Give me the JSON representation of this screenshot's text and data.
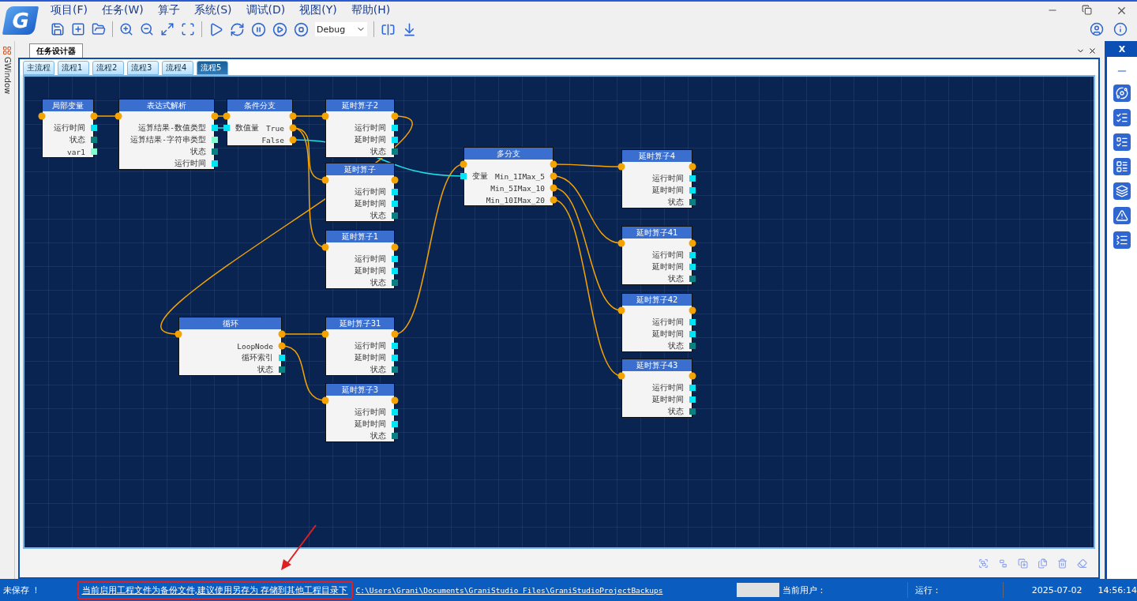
{
  "logo": "G",
  "menu": [
    "项目(F)",
    "任务(W)",
    "算子",
    "系统(S)",
    "调试(D)",
    "视图(Y)",
    "帮助(H)"
  ],
  "toolbar": {
    "mode": "Debug"
  },
  "side_strip": {
    "label": "GWindow"
  },
  "document_tab": {
    "title": "任务设计器"
  },
  "flow_tabs": [
    {
      "label": "主流程",
      "selected": false
    },
    {
      "label": "流程1",
      "selected": false
    },
    {
      "label": "流程2",
      "selected": false
    },
    {
      "label": "流程3",
      "selected": false
    },
    {
      "label": "流程4",
      "selected": false
    },
    {
      "label": "流程5",
      "selected": true
    }
  ],
  "nodes": [
    {
      "title": "局部变量",
      "exec_in": true,
      "exec_out": true,
      "rows": [
        {
          "right": {
            "label": "运行时间",
            "kind": "number"
          }
        },
        {
          "right": {
            "label": "状态",
            "kind": "status"
          }
        },
        {
          "right": {
            "label": "var1",
            "kind": "string"
          }
        }
      ]
    },
    {
      "title": "表达式解析",
      "exec_in": true,
      "exec_out": true,
      "rows": [
        {
          "right": {
            "label": "运算结果-数值类型",
            "kind": "number"
          }
        },
        {
          "right": {
            "label": "运算结果-字符串类型",
            "kind": "string"
          }
        },
        {
          "right": {
            "label": "状态",
            "kind": "status"
          }
        },
        {
          "right": {
            "label": "运行时间",
            "kind": "number"
          }
        }
      ]
    },
    {
      "title": "条件分支",
      "exec_in": true,
      "exec_out": true,
      "rows": [
        {
          "left": {
            "label": "数值量",
            "kind": "number"
          },
          "right": {
            "label": "True",
            "kind": "exec"
          }
        },
        {
          "right": {
            "label": "False",
            "kind": "exec"
          }
        }
      ]
    },
    {
      "title": "延时算子2",
      "exec_in": true,
      "exec_out": true,
      "rows": [
        {
          "right": {
            "label": "运行时间",
            "kind": "number"
          }
        },
        {
          "right": {
            "label": "延时时间",
            "kind": "number"
          }
        },
        {
          "right": {
            "label": "状态",
            "kind": "status"
          }
        }
      ]
    },
    {
      "title": "延时算子",
      "exec_in": true,
      "exec_out": true,
      "rows": [
        {
          "right": {
            "label": "运行时间",
            "kind": "number"
          }
        },
        {
          "right": {
            "label": "延时时间",
            "kind": "number"
          }
        },
        {
          "right": {
            "label": "状态",
            "kind": "status"
          }
        }
      ]
    },
    {
      "title": "延时算子1",
      "exec_in": true,
      "exec_out": true,
      "rows": [
        {
          "right": {
            "label": "运行时间",
            "kind": "number"
          }
        },
        {
          "right": {
            "label": "延时时间",
            "kind": "number"
          }
        },
        {
          "right": {
            "label": "状态",
            "kind": "status"
          }
        }
      ]
    },
    {
      "title": "循环",
      "exec_in": true,
      "exec_out": true,
      "rows": [
        {
          "right": {
            "label": "LoopNode",
            "kind": "exec"
          }
        },
        {
          "right": {
            "label": "循环索引",
            "kind": "number"
          }
        },
        {
          "right": {
            "label": "状态",
            "kind": "status"
          }
        }
      ]
    },
    {
      "title": "延时算子31",
      "exec_in": true,
      "exec_out": true,
      "rows": [
        {
          "right": {
            "label": "运行时间",
            "kind": "number"
          }
        },
        {
          "right": {
            "label": "延时时间",
            "kind": "number"
          }
        },
        {
          "right": {
            "label": "状态",
            "kind": "status"
          }
        }
      ]
    },
    {
      "title": "延时算子3",
      "exec_in": true,
      "exec_out": true,
      "rows": [
        {
          "right": {
            "label": "运行时间",
            "kind": "number"
          }
        },
        {
          "right": {
            "label": "延时时间",
            "kind": "number"
          }
        },
        {
          "right": {
            "label": "状态",
            "kind": "status"
          }
        }
      ]
    },
    {
      "title": "多分支",
      "exec_in": true,
      "exec_out": true,
      "rows": [
        {
          "left": {
            "label": "变量",
            "kind": "number"
          },
          "right": {
            "label": "Min_1IMax_5",
            "kind": "exec"
          }
        },
        {
          "right": {
            "label": "Min_5IMax_10",
            "kind": "exec"
          }
        },
        {
          "right": {
            "label": "Min_10IMax_20",
            "kind": "exec"
          }
        }
      ]
    },
    {
      "title": "延时算子4",
      "exec_in": true,
      "exec_out": true,
      "rows": [
        {
          "right": {
            "label": "运行时间",
            "kind": "number"
          }
        },
        {
          "right": {
            "label": "延时时间",
            "kind": "number"
          }
        },
        {
          "right": {
            "label": "状态",
            "kind": "status"
          }
        }
      ]
    },
    {
      "title": "延时算子41",
      "exec_in": true,
      "exec_out": true,
      "rows": [
        {
          "right": {
            "label": "运行时间",
            "kind": "number"
          }
        },
        {
          "right": {
            "label": "延时时间",
            "kind": "number"
          }
        },
        {
          "right": {
            "label": "状态",
            "kind": "status"
          }
        }
      ]
    },
    {
      "title": "延时算子42",
      "exec_in": true,
      "exec_out": true,
      "rows": [
        {
          "right": {
            "label": "运行时间",
            "kind": "number"
          }
        },
        {
          "right": {
            "label": "延时时间",
            "kind": "number"
          }
        },
        {
          "right": {
            "label": "状态",
            "kind": "status"
          }
        }
      ]
    },
    {
      "title": "延时算子43",
      "exec_in": true,
      "exec_out": true,
      "rows": [
        {
          "right": {
            "label": "运行时间",
            "kind": "number"
          }
        },
        {
          "right": {
            "label": "延时时间",
            "kind": "number"
          }
        },
        {
          "right": {
            "label": "状态",
            "kind": "status"
          }
        }
      ]
    }
  ],
  "right_panel": {
    "close": "X"
  },
  "status_bar": {
    "save_state": "未保存 ！",
    "notice": "当前启用工程文件为备份文件,建议使用另存为 存储到其他工程目录下",
    "path": "C:\\Users\\Grani\\Documents\\GraniStudio Files\\GraniStudioProjectBackups",
    "user_label": "当前用户：",
    "run_label": "运行：",
    "date": "2025-07-02",
    "time": "14:56:14"
  }
}
